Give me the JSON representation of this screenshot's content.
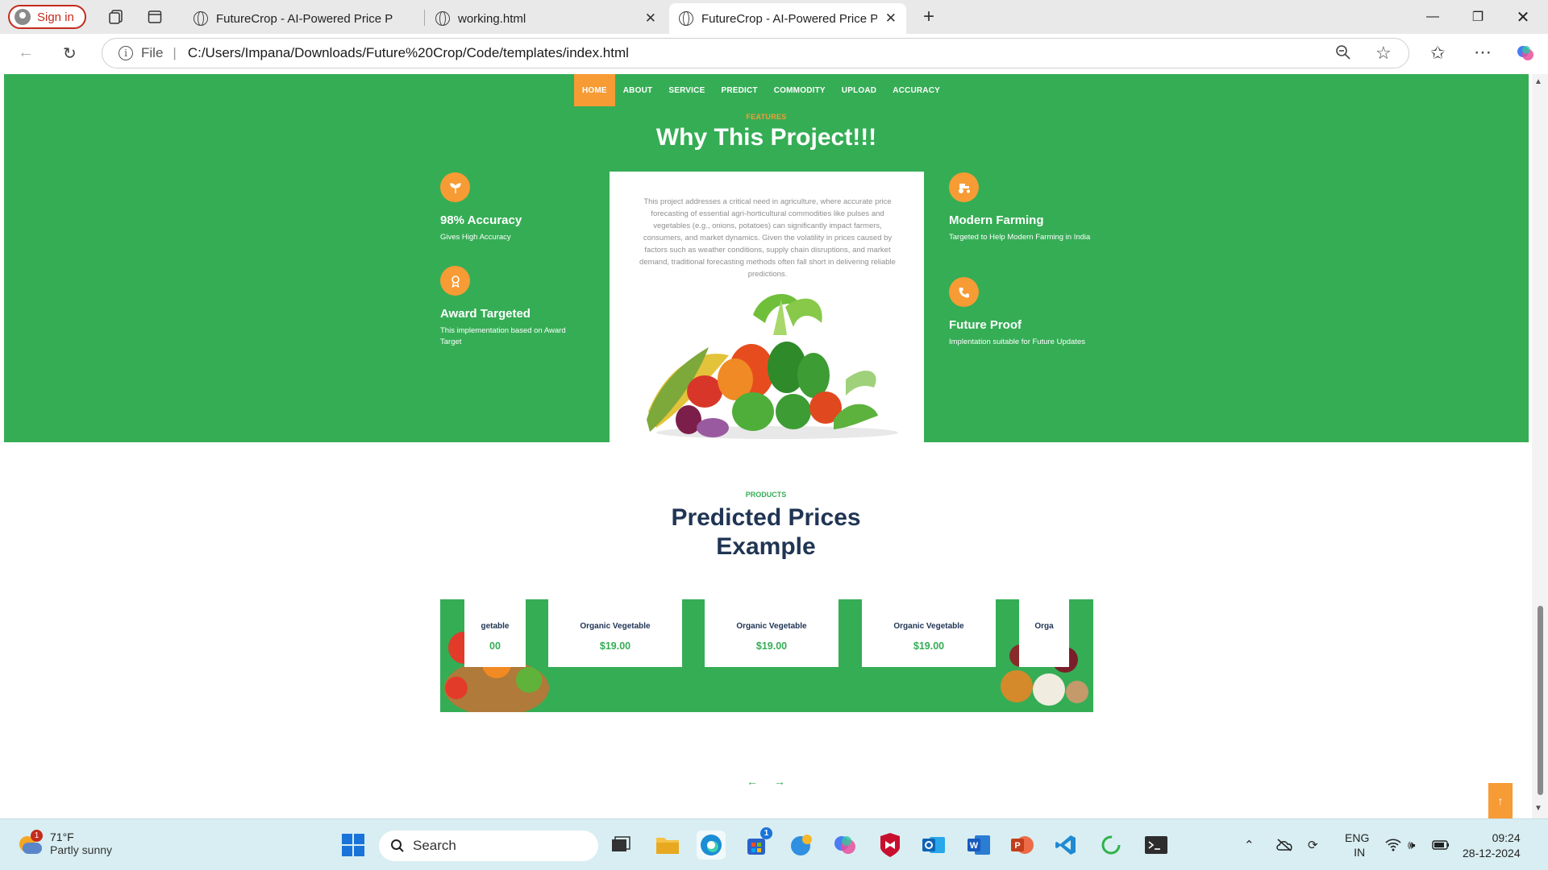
{
  "browser": {
    "signin_label": "Sign in",
    "tabs": [
      {
        "title": "FutureCrop - AI-Powered Price Pr"
      },
      {
        "title": "working.html"
      },
      {
        "title": "FutureCrop - AI-Powered Price Pr"
      }
    ],
    "address": {
      "scheme_label": "File",
      "url": "C:/Users/Impana/Downloads/Future%20Crop/Code/templates/index.html"
    }
  },
  "nav": {
    "items": [
      "HOME",
      "ABOUT",
      "SERVICE",
      "PREDICT",
      "COMMODITY",
      "UPLOAD",
      "ACCURACY"
    ],
    "active_index": 0
  },
  "features": {
    "kicker": "FEATURES",
    "title": "Why This Project!!!",
    "left": [
      {
        "icon": "seedling-icon",
        "heading": "98% Accuracy",
        "text": "Gives High Accuracy"
      },
      {
        "icon": "award-icon",
        "heading": "Award Targeted",
        "text": "This implementation based on Award Target"
      }
    ],
    "right": [
      {
        "icon": "tractor-icon",
        "heading": "Modern Farming",
        "text": "Targeted to Help Modern Farming in India"
      },
      {
        "icon": "phone-icon",
        "heading": "Future Proof",
        "text": "Implentation suitable for Future Updates"
      }
    ],
    "description": "This project addresses a critical need in agriculture, where accurate price forecasting of essential agri-horticultural commodities like pulses and vegetables (e.g., onions, potatoes) can significantly impact farmers, consumers, and market dynamics. Given the volatility in prices caused by factors such as weather conditions, supply chain disruptions, and market demand, traditional forecasting methods often fall short in delivering reliable predictions."
  },
  "products": {
    "kicker": "PRODUCTS",
    "title_line1": "Predicted Prices",
    "title_line2": "Example",
    "cards": [
      {
        "name": "getable",
        "price": "00"
      },
      {
        "name": "Organic Vegetable",
        "price": "$19.00"
      },
      {
        "name": "Organic Vegetable",
        "price": "$19.00"
      },
      {
        "name": "Organic Vegetable",
        "price": "$19.00"
      },
      {
        "name": "Orga",
        "price": ""
      }
    ]
  },
  "taskbar": {
    "weather_temp": "71°F",
    "weather_desc": "Partly sunny",
    "weather_badge": "1",
    "search_placeholder": "Search",
    "store_badge": "1",
    "lang_line1": "ENG",
    "lang_line2": "IN",
    "time": "09:24",
    "date": "28-12-2024"
  },
  "colors": {
    "green": "#35ad55",
    "orange": "#f79b35",
    "navy": "#203554"
  }
}
